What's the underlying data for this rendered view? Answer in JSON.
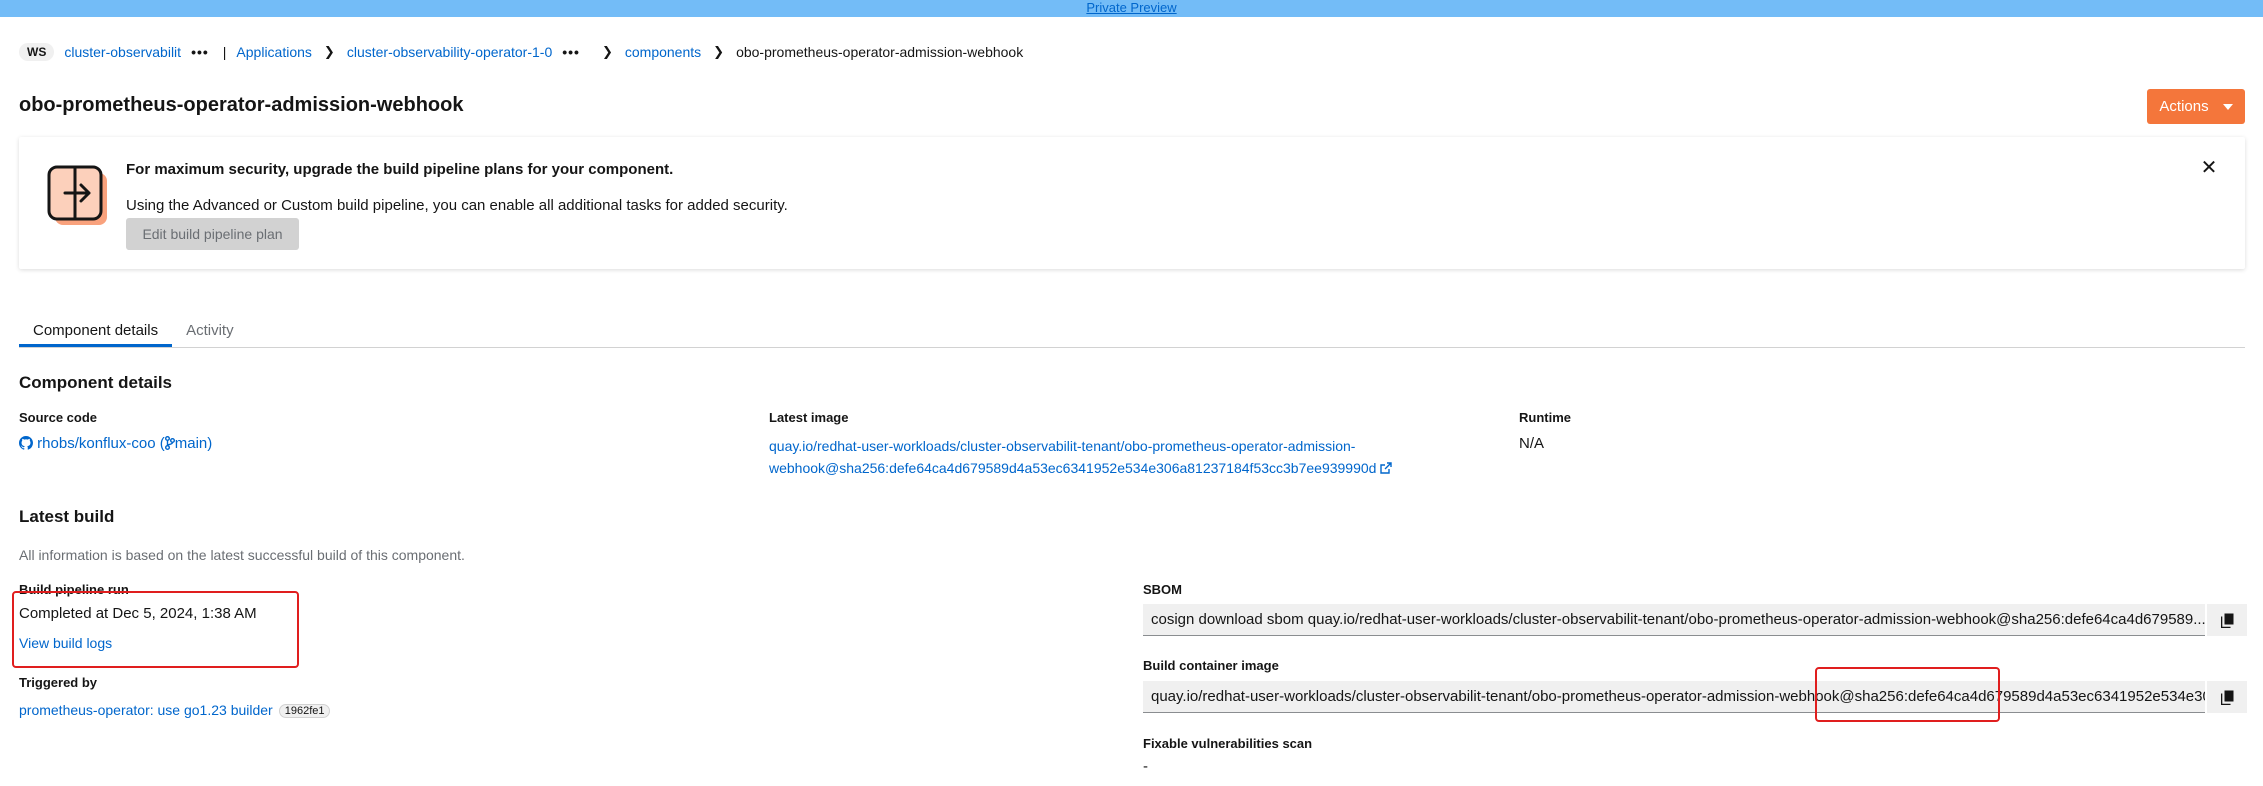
{
  "banner": {
    "text": "Private Preview"
  },
  "breadcrumb": {
    "ws_badge": "WS",
    "workspace": "cluster-observabilit",
    "applications": "Applications",
    "application": "cluster-observability-operator-1-0",
    "components": "components",
    "current": "obo-prometheus-operator-admission-webhook"
  },
  "page": {
    "title": "obo-prometheus-operator-admission-webhook",
    "actions_label": "Actions"
  },
  "upgrade_card": {
    "title": "For maximum security, upgrade the build pipeline plans for your component.",
    "description": "Using the Advanced or Custom build pipeline, you can enable all additional tasks for added security.",
    "button_label": "Edit build pipeline plan"
  },
  "tabs": [
    {
      "label": "Component details",
      "active": true
    },
    {
      "label": "Activity",
      "active": false
    }
  ],
  "component_details": {
    "title": "Component details",
    "source_code_label": "Source code",
    "source_repo": "rhobs/konflux-coo",
    "source_branch": "main",
    "latest_image_label": "Latest image",
    "latest_image_line1": "quay.io/redhat-user-workloads/cluster-observabilit-tenant/obo-prometheus-operator-admission-",
    "latest_image_line2": "webhook@sha256:defe64ca4d679589d4a53ec6341952e534e306a81237184f53cc3b7ee939990d",
    "runtime_label": "Runtime",
    "runtime_value": "N/A"
  },
  "latest_build": {
    "title": "Latest build",
    "note": "All information is based on the latest successful build of this component.",
    "pipeline_run_label": "Build pipeline run",
    "completed": "Completed at Dec 5, 2024, 1:38 AM",
    "view_logs": "View build logs",
    "triggered_by_label": "Triggered by",
    "triggered_commit_msg": "prometheus-operator: use go1.23 builder",
    "triggered_commit_sha": "1962fe1",
    "sbom_label": "SBOM",
    "sbom_command": "cosign download sbom quay.io/redhat-user-workloads/cluster-observabilit-tenant/obo-prometheus-operator-admission-webhook@sha256:defe64ca4d679589...",
    "container_image_label": "Build container image",
    "container_image_value": "quay.io/redhat-user-workloads/cluster-observabilit-tenant/obo-prometheus-operator-admission-webhook@sha256:defe64ca4d679589d4a53ec6341952e534e30",
    "fixable_vulns_label": "Fixable vulnerabilities scan",
    "fixable_vulns_value": "-"
  },
  "colors": {
    "banner": "#73bcf7",
    "link": "#0066cc",
    "actions": "#f4763b",
    "annotation": "#e01e1e"
  },
  "icons": [
    "more-horizontal-icon",
    "chevron-right-icon",
    "caret-down-icon",
    "pipeline-upgrade-icon",
    "close-icon",
    "github-icon",
    "branch-icon",
    "external-link-icon",
    "copy-icon"
  ]
}
